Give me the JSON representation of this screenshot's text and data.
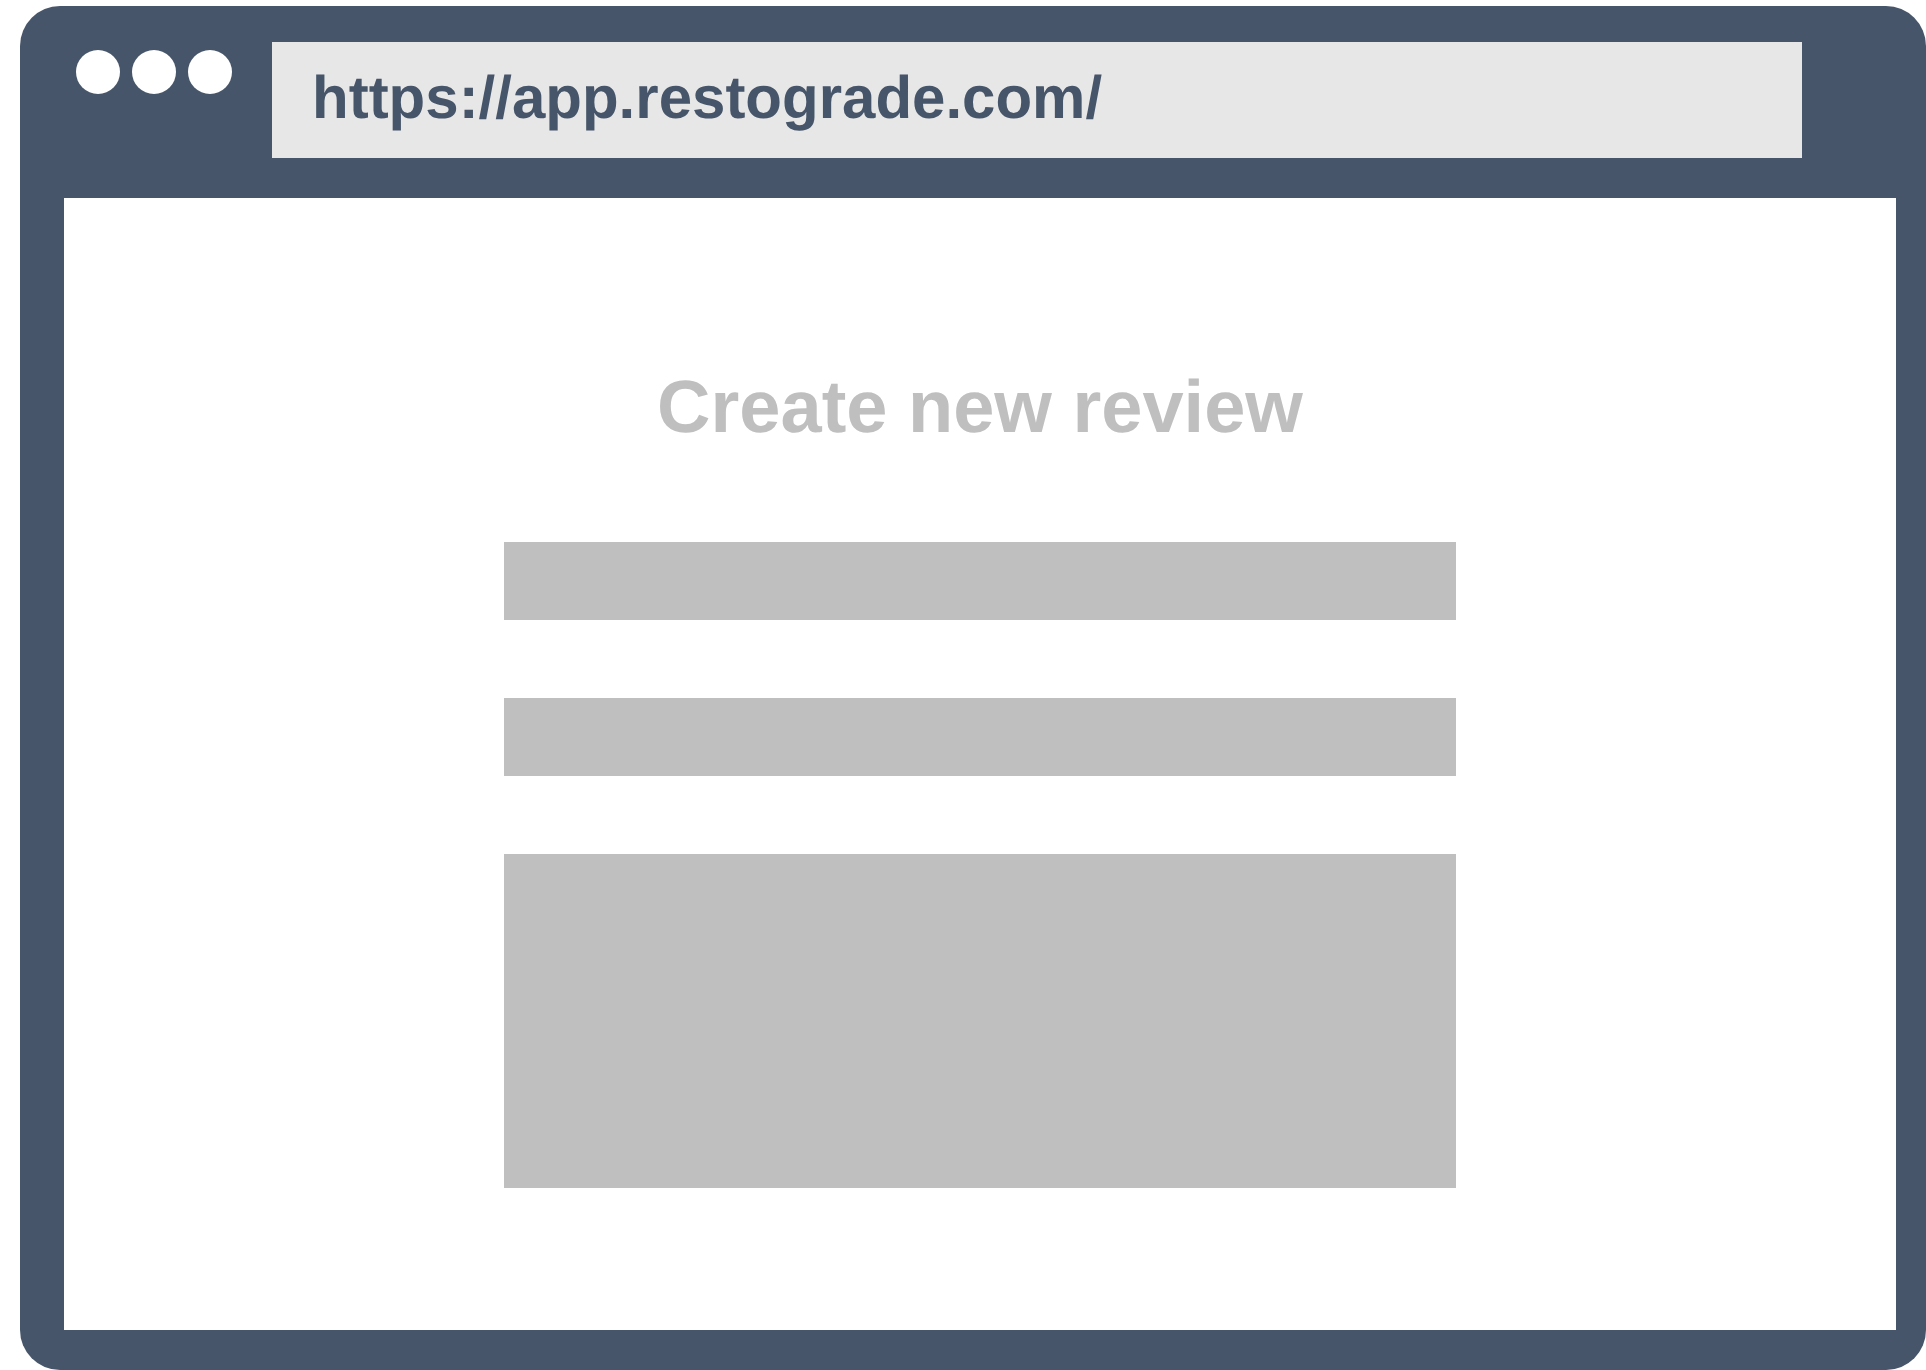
{
  "window": {
    "address": "https://app.restograde.com/"
  },
  "form": {
    "title": "Create new review",
    "fields": [
      {
        "kind": "line"
      },
      {
        "kind": "line"
      },
      {
        "kind": "area"
      }
    ]
  }
}
